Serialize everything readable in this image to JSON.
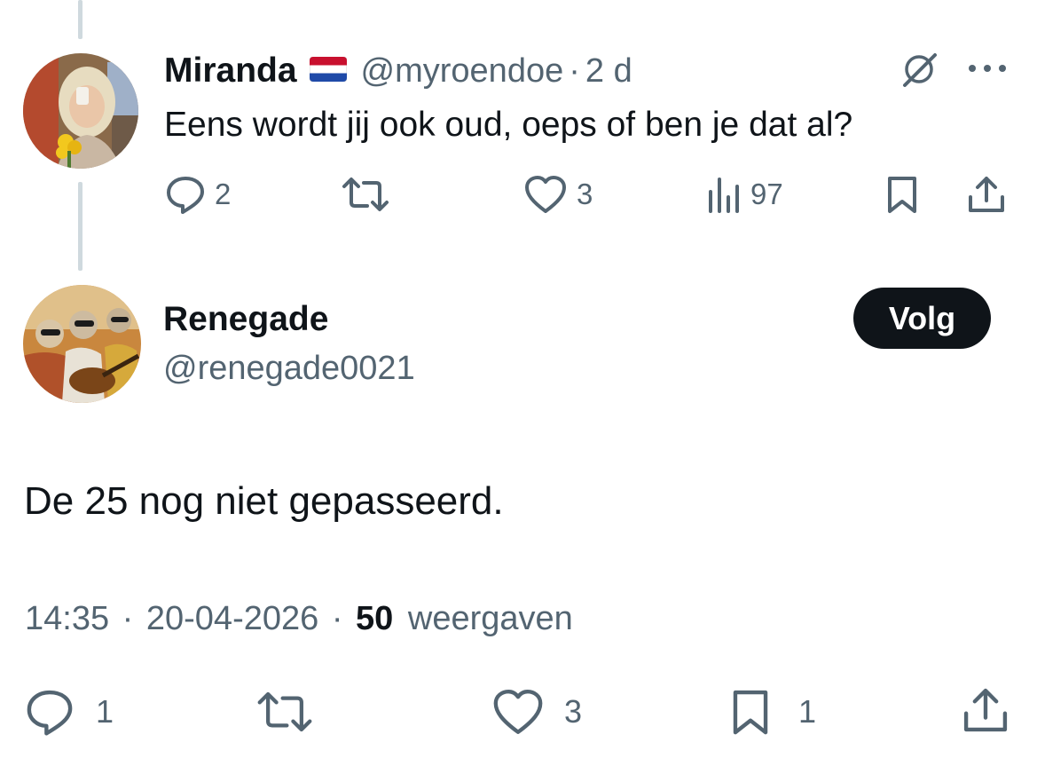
{
  "parent_tweet": {
    "display_name": "Miranda",
    "flag": "Netherlands flag",
    "handle": "@myroendoe",
    "separator": "·",
    "time": "2 d",
    "text": "Eens wordt jij ook oud, oeps of ben je dat al?",
    "replies": "2",
    "likes": "3",
    "views": "97"
  },
  "main_tweet": {
    "display_name": "Renegade",
    "handle": "@renegade0021",
    "follow_label": "Volg",
    "text": "De 25 nog niet gepasseerd.",
    "time": "14:35",
    "date": "20-04-2026",
    "separator": "·",
    "views_count": "50",
    "views_label": "weergaven",
    "replies": "1",
    "likes": "3",
    "bookmarks": "1"
  },
  "icons": {
    "reply": "reply-icon",
    "retweet": "retweet-icon",
    "like": "heart-icon",
    "views": "views-icon",
    "bookmark": "bookmark-icon",
    "share": "share-icon",
    "more": "more-icon",
    "grok": "grok-icon"
  },
  "colors": {
    "text_primary": "#0f1419",
    "text_secondary": "#536471",
    "thread_line": "#cfd9de",
    "button_bg": "#0f1419",
    "button_text": "#ffffff"
  }
}
